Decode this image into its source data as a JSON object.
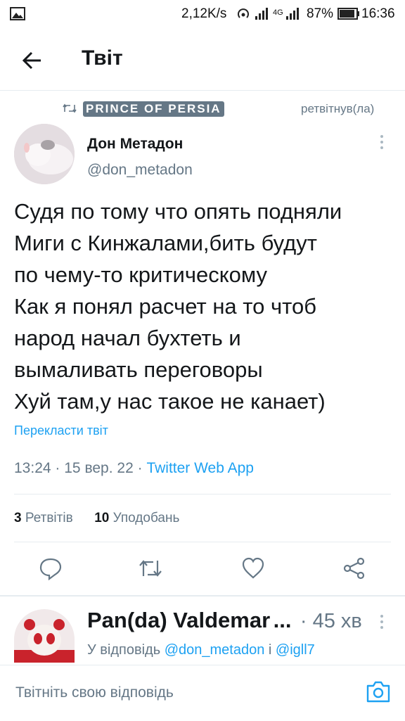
{
  "status_bar": {
    "network_speed": "2,12K/s",
    "network_type": "4G",
    "battery": "87%",
    "time": "16:36"
  },
  "header": {
    "title": "Твіт"
  },
  "retweet": {
    "retweeter": "PRINCE OF PERSIA",
    "action": "ретвітнув(ла)"
  },
  "tweet": {
    "author_name": "Дон Метадон",
    "author_handle": "@don_metadon",
    "text": "Судя по тому что опять подняли\nМиги с Кинжалами,бить будут\nпо чему-то критическому\nКак я понял расчет на то чтоб\nнарод начал бухтеть и\nвымаливать переговоры\nХуй там,у нас такое не канает)",
    "translate": "Перекласти твіт",
    "time": "13:24",
    "date": "15 вер. 22",
    "separator": "·",
    "source": "Twitter Web App",
    "retweets_count": "3",
    "retweets_label": "Ретвітів",
    "likes_count": "10",
    "likes_label": "Уподобань"
  },
  "reply": {
    "author_name": "Pan(da) Valdemar",
    "ellipsis": "...",
    "time": "· 45 хв",
    "reply_prefix": "У відповідь",
    "mention_1": "@don_metadon",
    "conjunction": "і",
    "mention_2": "@igll7"
  },
  "compose": {
    "placeholder": "Твітніть свою відповідь"
  },
  "colors": {
    "accent": "#1da1f2",
    "text": "#14171a",
    "muted": "#657786",
    "divider": "#e6ecf0"
  }
}
